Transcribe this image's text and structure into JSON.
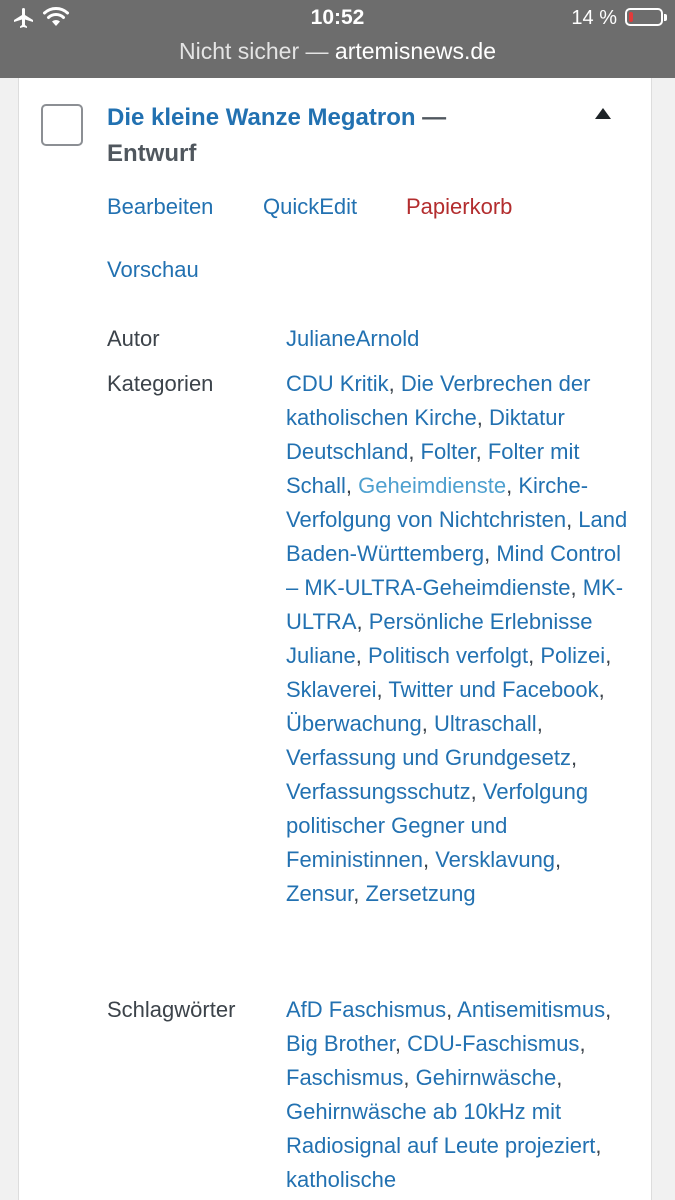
{
  "status_bar": {
    "time": "10:52",
    "battery": "14 %",
    "battery_level": 0.14,
    "icons": [
      "airplane-icon",
      "wifi-icon",
      "battery-icon"
    ]
  },
  "url_bar": {
    "prefix": "Nicht sicher — ",
    "domain": "artemisnews.de"
  },
  "post": {
    "title": "Die kleine Wanze Megatron",
    "dash": " —",
    "state": "Entwurf",
    "actions": {
      "edit": "Bearbeiten",
      "quickedit": "QuickEdit",
      "trash": "Papierkorb",
      "preview": "Vorschau"
    },
    "author_label": "Autor",
    "author": "JulianeArnold",
    "categories_label": "Kategorien",
    "categories": [
      "CDU Kritik",
      "Die Verbrechen der katholischen Kirche",
      "Diktatur Deutschland",
      "Folter",
      "Folter mit Schall",
      "Geheimdienste",
      "Kirche-Verfolgung von Nichtchristen",
      "Land Baden-Württemberg",
      "Mind Control – MK-ULTRA-Geheimdienste",
      "MK-ULTRA",
      "Persönliche Erlebnisse Juliane",
      "Politisch verfolgt",
      "Polizei",
      "Sklaverei",
      "Twitter und Facebook",
      "Überwachung",
      "Ultraschall",
      "Verfassung und Grundgesetz",
      "Verfassungsschutz",
      "Verfolgung politischer Gegner und Feministinnen",
      "Versklavung",
      "Zensur",
      "Zersetzung"
    ],
    "tags_label": "Schlagwörter",
    "tags": [
      "AfD Faschismus",
      "Antisemitismus",
      "Big Brother",
      "CDU-Faschismus",
      "Faschismus",
      "Gehirnwäsche",
      "Gehirnwäsche ab 10kHz mit Radiosignal auf Leute projeziert",
      "katholische"
    ]
  }
}
